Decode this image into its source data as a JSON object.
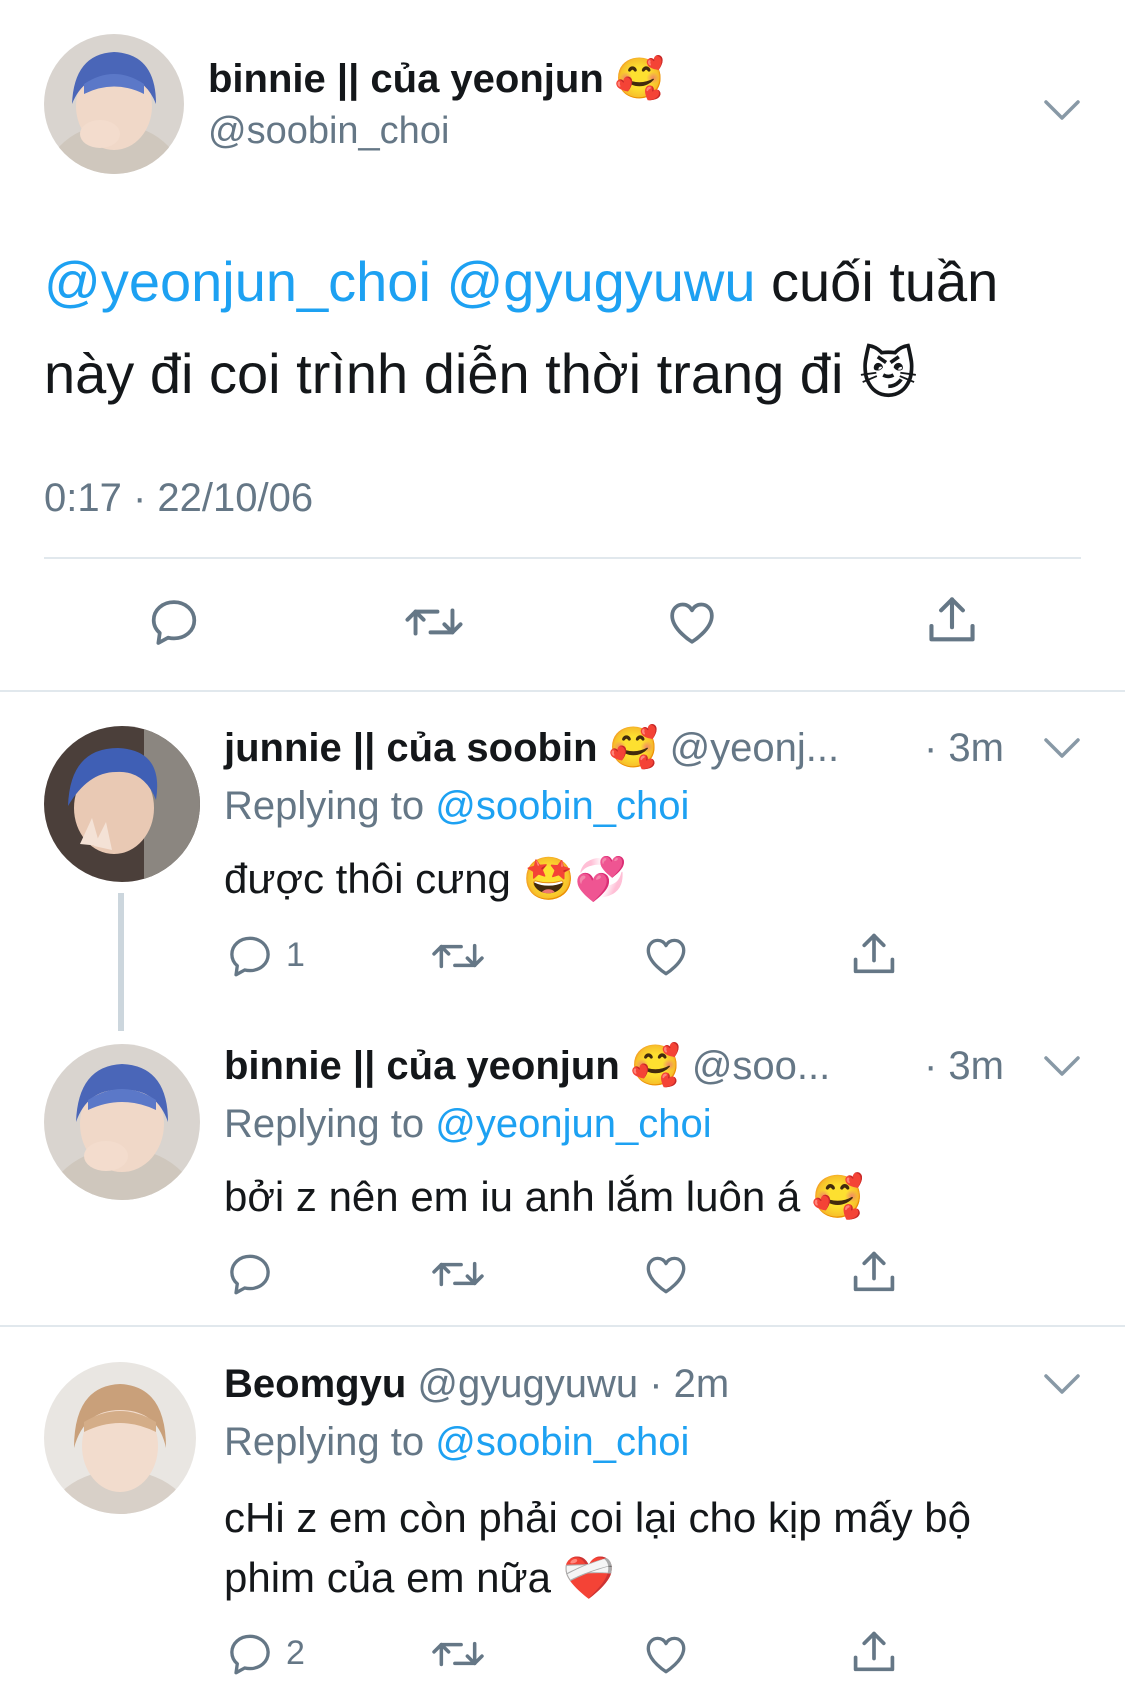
{
  "main_tweet": {
    "display_name": "binnie || của yeonjun",
    "name_emoji": "🥰",
    "handle": "@soobin_choi",
    "mention1": "@yeonjun_choi",
    "mention2": "@gyugyuwu",
    "text_line1_rest": " cuối tuần",
    "text_line2": "này đi coi trình diễn thời trang đi",
    "text_emoji": "😼",
    "timestamp": "0:17 · 22/10/06"
  },
  "replies": [
    {
      "display_name": "junnie || của soobin",
      "name_emoji": "🥰",
      "handle": "@yeonj...",
      "time": "· 3m",
      "replying_prefix": "Replying to ",
      "replying_handle": "@soobin_choi",
      "text": "được thôi cưng",
      "text_emoji": "🤩💞",
      "reply_count": "1"
    },
    {
      "display_name": "binnie || của yeonjun",
      "name_emoji": "🥰",
      "handle": "@soo...",
      "time": "· 3m",
      "replying_prefix": "Replying to ",
      "replying_handle": "@yeonjun_choi",
      "text": "bởi z nên em iu anh lắm luôn á",
      "text_emoji": "🥰",
      "reply_count": ""
    },
    {
      "display_name": "Beomgyu",
      "name_emoji": "",
      "handle": "@gyugyuwu",
      "time": "· 2m",
      "replying_prefix": "Replying to ",
      "replying_handle": "@soobin_choi",
      "text_line1": "cHi z em còn phải coi lại cho kịp mấy bộ",
      "text_line2": "phim của em nữa",
      "text_emoji": "❤️‍🩹",
      "reply_count": "2"
    }
  ],
  "colors": {
    "link": "#1da1f2",
    "secondary": "#657786",
    "divider": "#e1e8ed",
    "icon": "#657786"
  },
  "icons": [
    "chevron-down-icon",
    "reply-icon",
    "retweet-icon",
    "like-icon",
    "share-icon"
  ]
}
